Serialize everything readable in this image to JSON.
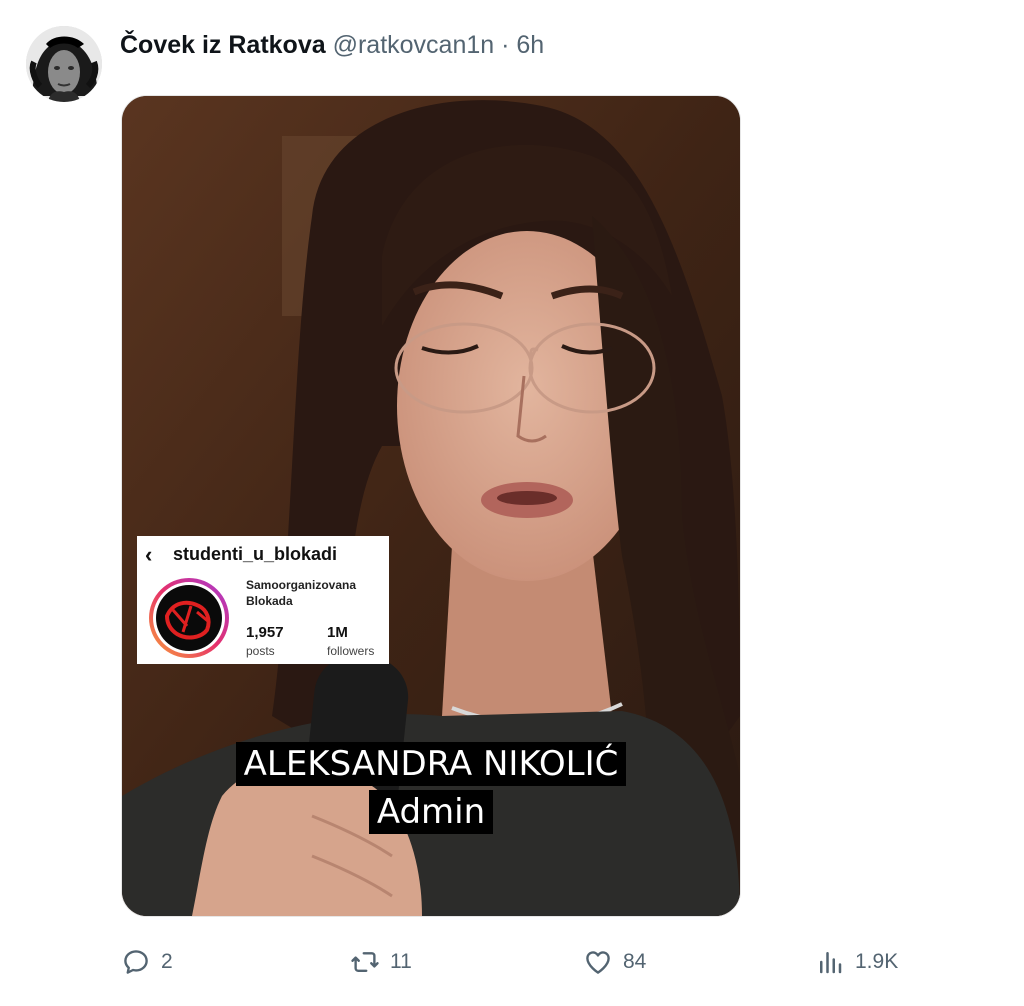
{
  "tweet": {
    "author_name": "Čovek iz Ratkova",
    "handle": "@ratkovcan1n",
    "separator": "·",
    "time": "6h"
  },
  "media": {
    "overlay_card": {
      "back_icon": "chevron-left-icon",
      "username": "studenti_u_blokadi",
      "bio_line1": "Samoorganizovana",
      "bio_line2": "Blokada",
      "posts_count": "1,957",
      "posts_label": "posts",
      "followers_count": "1M",
      "followers_label": "followers"
    },
    "caption": {
      "line1": "ALEKSANDRA NIKOLIĆ",
      "line2": "Admin"
    }
  },
  "actions": {
    "replies": "2",
    "reposts": "11",
    "likes": "84",
    "views": "1.9K"
  },
  "colors": {
    "text_primary": "#0f1419",
    "text_secondary": "#536471",
    "background": "#ffffff"
  }
}
